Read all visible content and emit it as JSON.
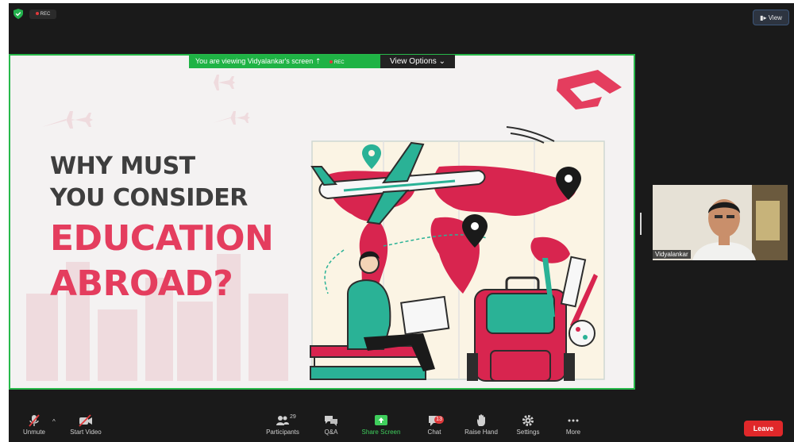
{
  "colors": {
    "window_bg": "#1a1a1a",
    "share_green": "#1fb345",
    "leave_red": "#e0282a",
    "slide_red": "#e43d5e",
    "slide_teal": "#2ab296"
  },
  "topbar": {
    "rec_label": "REC",
    "view_label": "View"
  },
  "share": {
    "banner_text": "You are viewing Vidyalankar's screen",
    "banner_rec": "REC",
    "view_options_label": "View Options"
  },
  "slide": {
    "line1": "WHY MUST",
    "line2": "YOU CONSIDER",
    "line3": "EDUCATION",
    "line4": "ABROAD?"
  },
  "participant": {
    "name": "Vidyalankar"
  },
  "toolbar": {
    "unmute": "Unmute",
    "start_video": "Start Video",
    "participants": "Participants",
    "participants_count": "29",
    "qa": "Q&A",
    "share_screen": "Share Screen",
    "chat": "Chat",
    "chat_badge": "13",
    "raise_hand": "Raise Hand",
    "settings": "Settings",
    "more": "More",
    "leave": "Leave"
  },
  "icons": [
    "shield-icon",
    "microphone-muted-icon",
    "video-off-icon",
    "participants-icon",
    "qa-icon",
    "share-screen-icon",
    "chat-icon",
    "hand-icon",
    "gear-icon",
    "more-dots-icon"
  ]
}
